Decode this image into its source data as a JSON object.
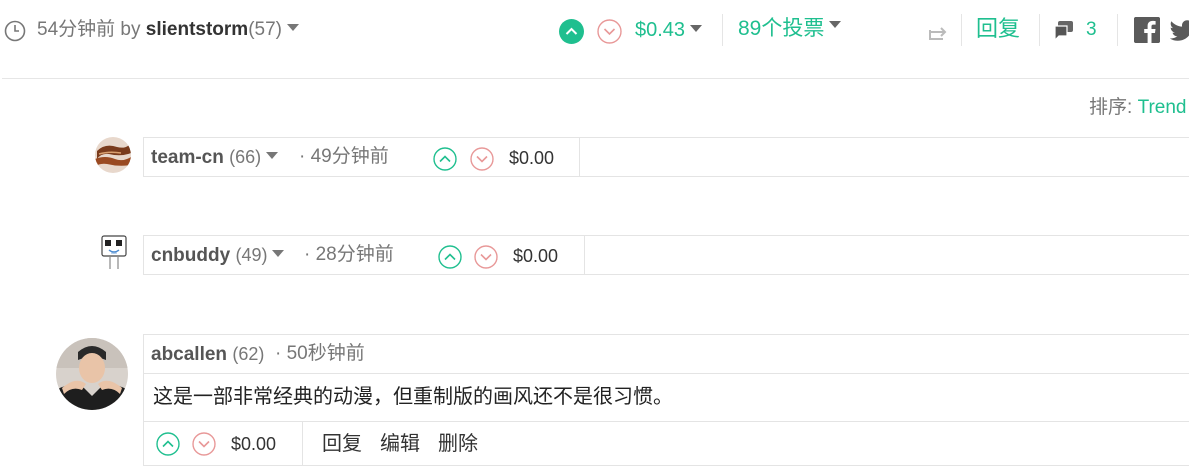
{
  "post": {
    "age": "54分钟前",
    "by": "by",
    "author": "slientstorm",
    "reputation": "(57)",
    "payout": "$0.43",
    "votes": "89个投票",
    "reply": "回复",
    "comment_count": "3"
  },
  "sort": {
    "label": "排序:",
    "value": "Trend"
  },
  "comments": [
    {
      "author": "team-cn",
      "reputation": "(66)",
      "time": "· 49分钟前",
      "payout": "$0.00"
    },
    {
      "author": "cnbuddy",
      "reputation": "(49)",
      "time": "· 28分钟前",
      "payout": "$0.00"
    },
    {
      "author": "abcallen",
      "reputation": "(62)",
      "time": "· 50秒钟前",
      "body": "这是一部非常经典的动漫，但重制版的画风还不是很习惯。",
      "payout": "$0.00",
      "actions": {
        "reply": "回复",
        "edit": "编辑",
        "delete": "删除"
      }
    }
  ],
  "icons": {
    "clock": "clock-icon",
    "upvote": "upvote-icon",
    "downvote": "downvote-icon",
    "repost": "repost-icon",
    "comments": "comments-icon",
    "facebook": "facebook-icon",
    "twitter": "twitter-icon"
  },
  "colors": {
    "accent": "#1fbf8f",
    "downvote": "#e89898",
    "muted": "#777777"
  }
}
